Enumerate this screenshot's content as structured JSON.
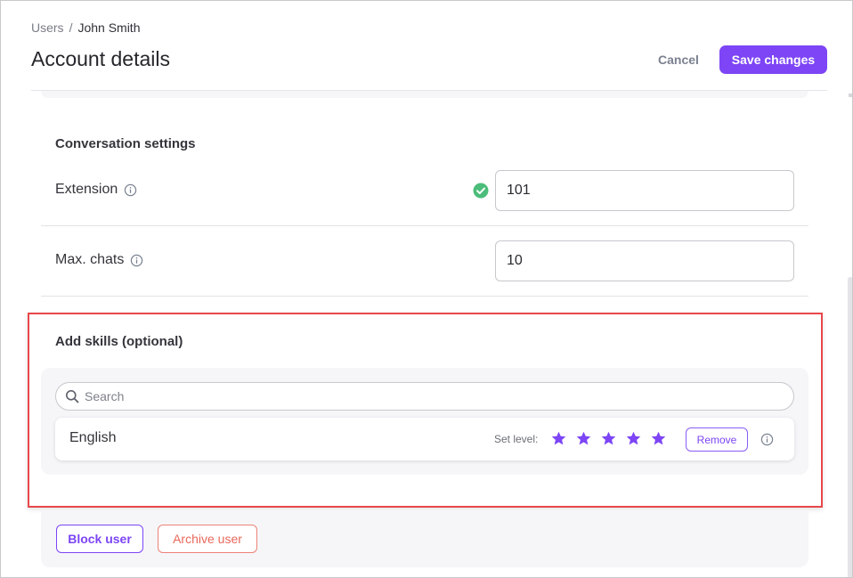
{
  "breadcrumb": {
    "parent": "Users",
    "separator": "/",
    "current": "John Smith"
  },
  "header": {
    "title": "Account details",
    "cancel_label": "Cancel",
    "save_label": "Save changes",
    "accent_color": "#7d45f5"
  },
  "conversation_settings": {
    "heading": "Conversation settings",
    "extension": {
      "label": "Extension",
      "value": "101",
      "validated": true,
      "validated_icon": "check-circle-icon"
    },
    "max_chats": {
      "label": "Max. chats",
      "value": "10"
    }
  },
  "skills": {
    "heading": "Add skills (optional)",
    "search": {
      "placeholder": "Search",
      "value": ""
    },
    "items": [
      {
        "name": "English",
        "set_level_label": "Set level:",
        "level": 5,
        "max_level": 5,
        "remove_label": "Remove"
      }
    ],
    "highlight_color": "#e8474a"
  },
  "account_actions": {
    "block_label": "Block user",
    "archive_label": "Archive user",
    "archive_color": "#e8685c"
  }
}
